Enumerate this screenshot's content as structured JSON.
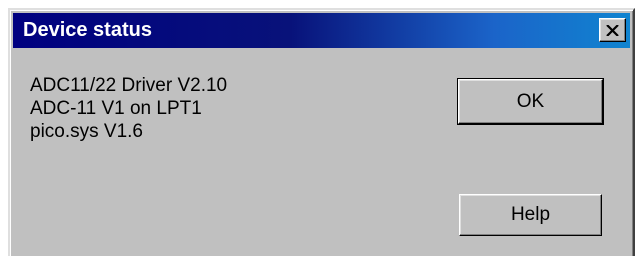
{
  "window": {
    "title": "Device status"
  },
  "titlebar": {
    "close_icon": "close-x-icon"
  },
  "info": {
    "lines": [
      "ADC11/22 Driver V2.10",
      "ADC-11 V1 on LPT1",
      "pico.sys V1.6"
    ]
  },
  "buttons": {
    "ok_label": "OK",
    "help_label": "Help"
  },
  "colors": {
    "titlebar_start": "#000080",
    "titlebar_end": "#1084d0",
    "face": "#c0c0c0"
  }
}
